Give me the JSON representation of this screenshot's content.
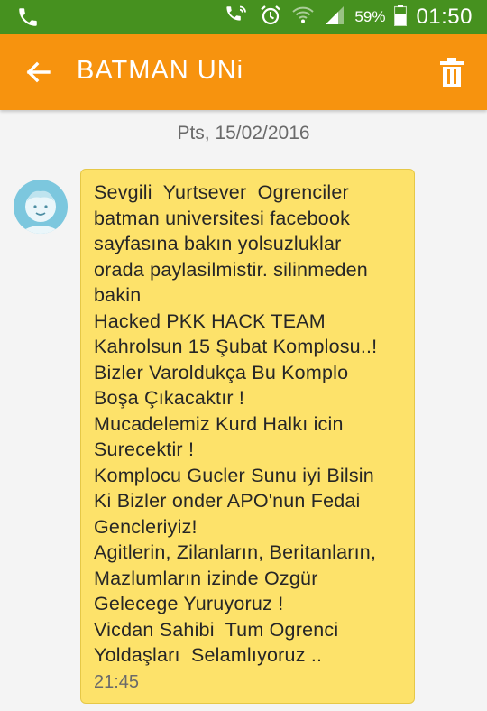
{
  "status_bar": {
    "battery_percent": "59%",
    "time": "01:50",
    "icons": [
      "phone-icon",
      "wifi-call-icon",
      "alarm-icon",
      "wifi-icon",
      "signal-icon",
      "battery-icon"
    ],
    "color": "#46911f"
  },
  "app_bar": {
    "title": "BATMAN UNi",
    "color": "#f7930e",
    "icons": [
      "back-arrow-icon",
      "trash-icon"
    ]
  },
  "conversation": {
    "date": "Pts, 15/02/2016",
    "message": {
      "lines": [
        "Sevgili  Yurtsever  Ogrenciler",
        "batman universitesi facebook",
        "sayfasına bakın yolsuzluklar",
        "orada paylasilmistir. silinmeden",
        "bakin",
        "Hacked PKK HACK TEAM",
        "Kahrolsun 15 Şubat Komplosu..!",
        "Bizler Varoldukça Bu Komplo",
        "Boşa Çıkacaktır !",
        "Mucadelemiz Kurd Halkı icin",
        "Surecektir !",
        "Komplocu Gucler Sunu iyi Bilsin",
        "Ki Bizler onder APO'nun Fedai",
        "Gencleriyiz!",
        "Agitlerin, Zilanların, Beritanların,",
        "Mazlumların izinde Ozgür",
        "Gelecege Yuruyoruz !",
        "Vicdan Sahibi  Tum Ogrenci",
        "Yoldaşları  Selamlıyoruz .."
      ],
      "time": "21:45",
      "bubble_color": "#fde26a"
    }
  }
}
